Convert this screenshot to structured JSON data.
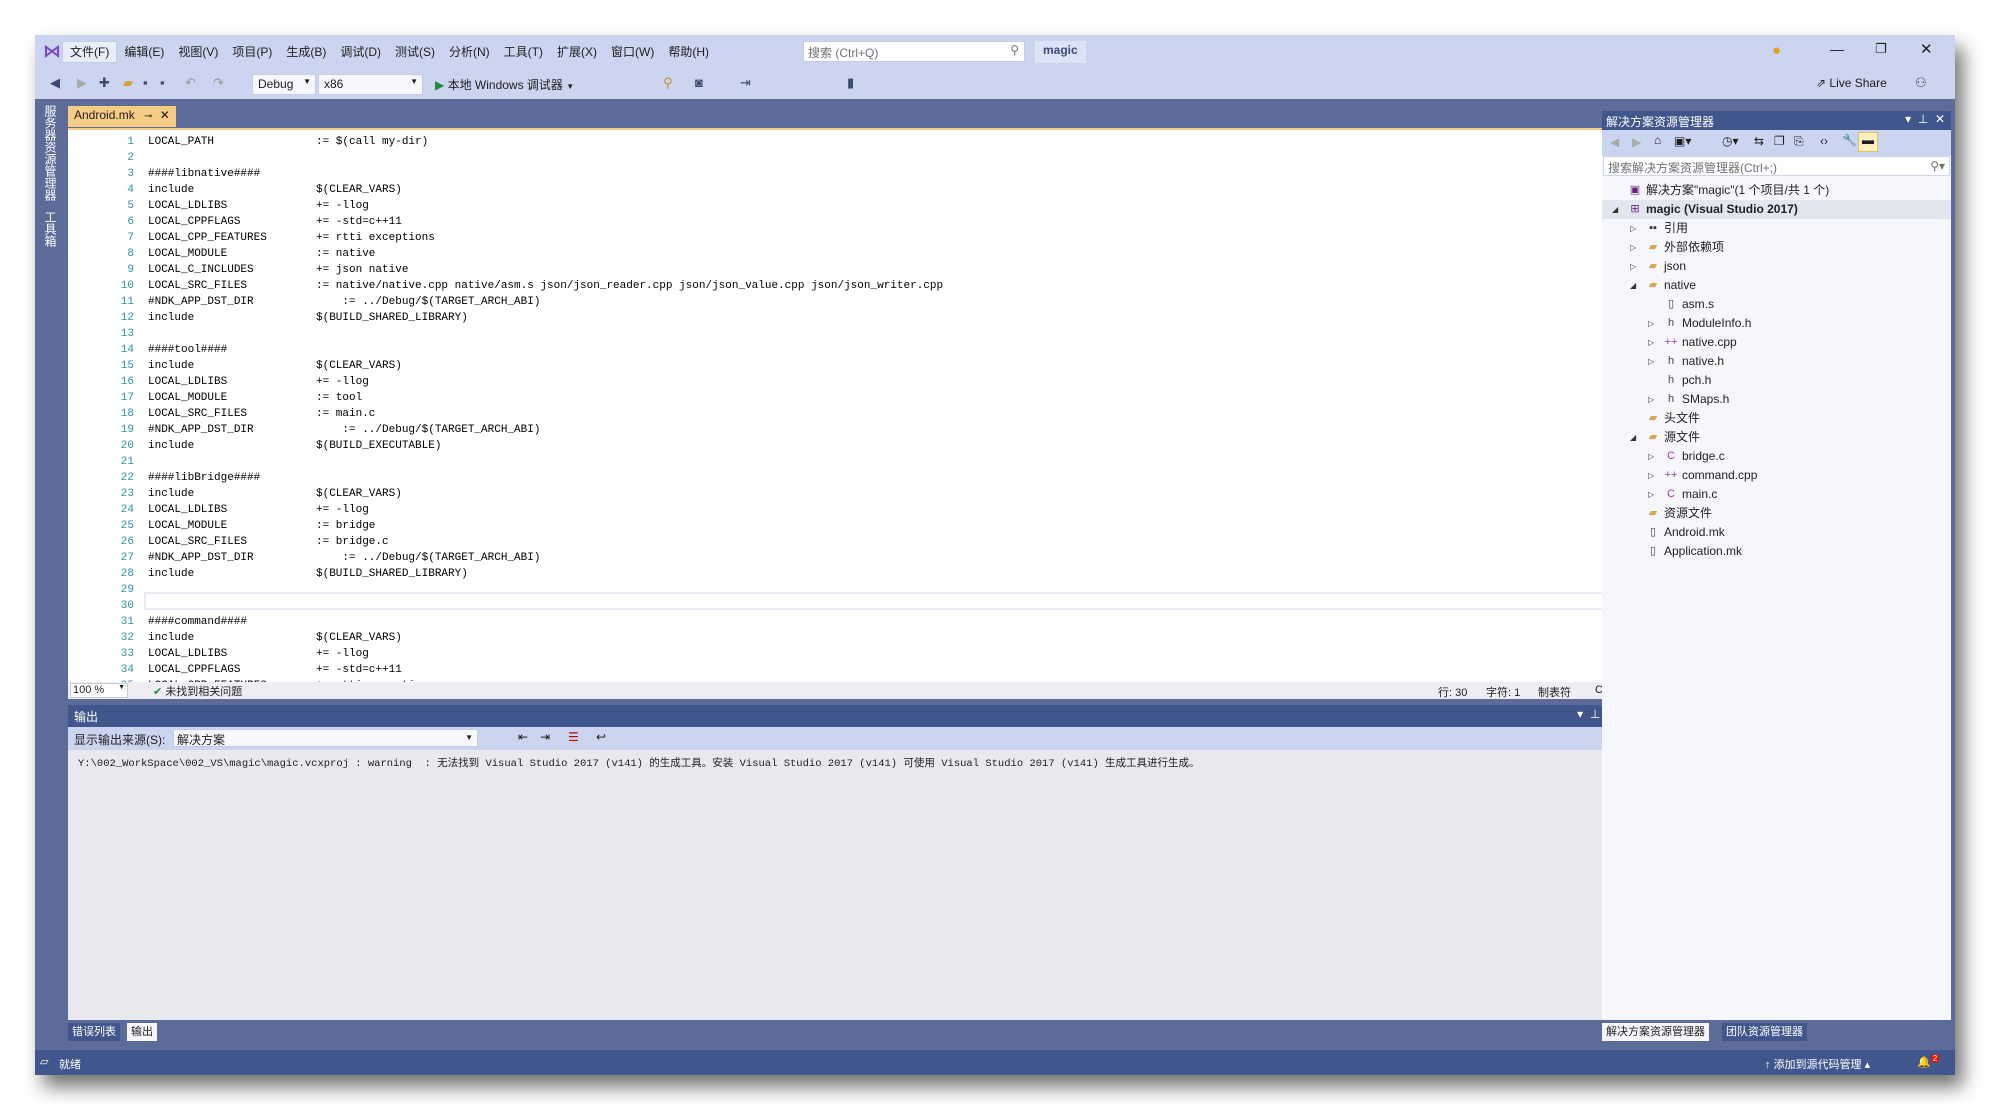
{
  "menu": [
    "文件(F)",
    "编辑(E)",
    "视图(V)",
    "项目(P)",
    "生成(B)",
    "调试(D)",
    "测试(S)",
    "分析(N)",
    "工具(T)",
    "扩展(X)",
    "窗口(W)",
    "帮助(H)"
  ],
  "search_placeholder": "搜索 (Ctrl+Q)",
  "solution_name": "magic",
  "live_share": "Live Share",
  "toolbar": {
    "config": "Debug",
    "platform": "x86",
    "run": "本地 Windows 调试器"
  },
  "left_tabs": [
    "服务器资源管理器",
    "工具箱"
  ],
  "doc_tab": "Android.mk",
  "code": [
    [
      "LOCAL_PATH",
      ":= $(call my-dir)"
    ],
    [
      "",
      ""
    ],
    [
      "####libnative####",
      ""
    ],
    [
      "include",
      "$(CLEAR_VARS)"
    ],
    [
      "LOCAL_LDLIBS",
      "+= -llog"
    ],
    [
      "LOCAL_CPPFLAGS",
      "+= -std=c++11"
    ],
    [
      "LOCAL_CPP_FEATURES",
      "+= rtti exceptions"
    ],
    [
      "LOCAL_MODULE",
      ":= native"
    ],
    [
      "LOCAL_C_INCLUDES",
      "+= json native"
    ],
    [
      "LOCAL_SRC_FILES",
      ":= native/native.cpp native/asm.s json/json_reader.cpp json/json_value.cpp json/json_writer.cpp"
    ],
    [
      "#NDK_APP_DST_DIR",
      "    := ../Debug/$(TARGET_ARCH_ABI)"
    ],
    [
      "include",
      "$(BUILD_SHARED_LIBRARY)"
    ],
    [
      "",
      ""
    ],
    [
      "####tool####",
      ""
    ],
    [
      "include",
      "$(CLEAR_VARS)"
    ],
    [
      "LOCAL_LDLIBS",
      "+= -llog"
    ],
    [
      "LOCAL_MODULE",
      ":= tool"
    ],
    [
      "LOCAL_SRC_FILES",
      ":= main.c"
    ],
    [
      "#NDK_APP_DST_DIR",
      "    := ../Debug/$(TARGET_ARCH_ABI)"
    ],
    [
      "include",
      "$(BUILD_EXECUTABLE)"
    ],
    [
      "",
      ""
    ],
    [
      "####libBridge####",
      ""
    ],
    [
      "include",
      "$(CLEAR_VARS)"
    ],
    [
      "LOCAL_LDLIBS",
      "+= -llog"
    ],
    [
      "LOCAL_MODULE",
      ":= bridge"
    ],
    [
      "LOCAL_SRC_FILES",
      ":= bridge.c"
    ],
    [
      "#NDK_APP_DST_DIR",
      "    := ../Debug/$(TARGET_ARCH_ABI)"
    ],
    [
      "include",
      "$(BUILD_SHARED_LIBRARY)"
    ],
    [
      "",
      ""
    ],
    [
      "",
      ""
    ],
    [
      "####command####",
      ""
    ],
    [
      "include",
      "$(CLEAR_VARS)"
    ],
    [
      "LOCAL_LDLIBS",
      "+= -llog"
    ],
    [
      "LOCAL_CPPFLAGS",
      "+= -std=c++11"
    ],
    [
      "LOCAL_CPP_FEATURES",
      "+= rtti exceptions"
    ]
  ],
  "editor_status": {
    "zoom": "100 %",
    "issues": "未找到相关问题",
    "line": "行: 30",
    "char": "字符: 1",
    "tabs": "制表符",
    "eol": "CRLF"
  },
  "output": {
    "title": "输出",
    "source_label": "显示输出来源(S):",
    "source_value": "解决方案",
    "text": "Y:\\002_WorkSpace\\002_VS\\magic\\magic.vcxproj : warning  : 无法找到 Visual Studio 2017 (v141) 的生成工具。安装 Visual Studio 2017 (v141) 可使用 Visual Studio 2017 (v141) 生成工具进行生成。"
  },
  "bottom_tabs": [
    "错误列表",
    "输出"
  ],
  "solution_explorer": {
    "title": "解决方案资源管理器",
    "search_placeholder": "搜索解决方案资源管理器(Ctrl+;)",
    "tree": [
      {
        "label": "解决方案\"magic\"(1 个项目/共 1 个)",
        "level": 0,
        "arrow": "",
        "icon": "solution"
      },
      {
        "label": "magic (Visual Studio 2017)",
        "level": 0,
        "arrow": "open",
        "icon": "project",
        "bold": true
      },
      {
        "label": "引用",
        "level": 1,
        "arrow": "closed",
        "icon": "references"
      },
      {
        "label": "外部依赖项",
        "level": 1,
        "arrow": "closed",
        "icon": "folder"
      },
      {
        "label": "json",
        "level": 1,
        "arrow": "closed",
        "icon": "folder"
      },
      {
        "label": "native",
        "level": 1,
        "arrow": "open",
        "icon": "folder"
      },
      {
        "label": "asm.s",
        "level": 2,
        "arrow": "",
        "icon": "file"
      },
      {
        "label": "ModuleInfo.h",
        "level": 2,
        "arrow": "closed",
        "icon": "header"
      },
      {
        "label": "native.cpp",
        "level": 2,
        "arrow": "closed",
        "icon": "cpp"
      },
      {
        "label": "native.h",
        "level": 2,
        "arrow": "closed",
        "icon": "header"
      },
      {
        "label": "pch.h",
        "level": 2,
        "arrow": "",
        "icon": "header"
      },
      {
        "label": "SMaps.h",
        "level": 2,
        "arrow": "closed",
        "icon": "header"
      },
      {
        "label": "头文件",
        "level": 1,
        "arrow": "",
        "icon": "folder"
      },
      {
        "label": "源文件",
        "level": 1,
        "arrow": "open",
        "icon": "folder"
      },
      {
        "label": "bridge.c",
        "level": 2,
        "arrow": "closed",
        "icon": "c"
      },
      {
        "label": "command.cpp",
        "level": 2,
        "arrow": "closed",
        "icon": "cpp"
      },
      {
        "label": "main.c",
        "level": 2,
        "arrow": "closed",
        "icon": "c"
      },
      {
        "label": "资源文件",
        "level": 1,
        "arrow": "",
        "icon": "folder"
      },
      {
        "label": "Android.mk",
        "level": 1,
        "arrow": "",
        "icon": "file"
      },
      {
        "label": "Application.mk",
        "level": 1,
        "arrow": "",
        "icon": "file"
      }
    ]
  },
  "right_tabs": [
    "解决方案资源管理器",
    "团队资源管理器"
  ],
  "status": {
    "ready": "就绪",
    "source_control": "添加到源代码管理",
    "notifications": "2"
  },
  "colors": {
    "accent": "#40568d",
    "chrome": "#ccd5f0",
    "tab": "#f5cc84",
    "line_numbers": "#2b91af"
  }
}
